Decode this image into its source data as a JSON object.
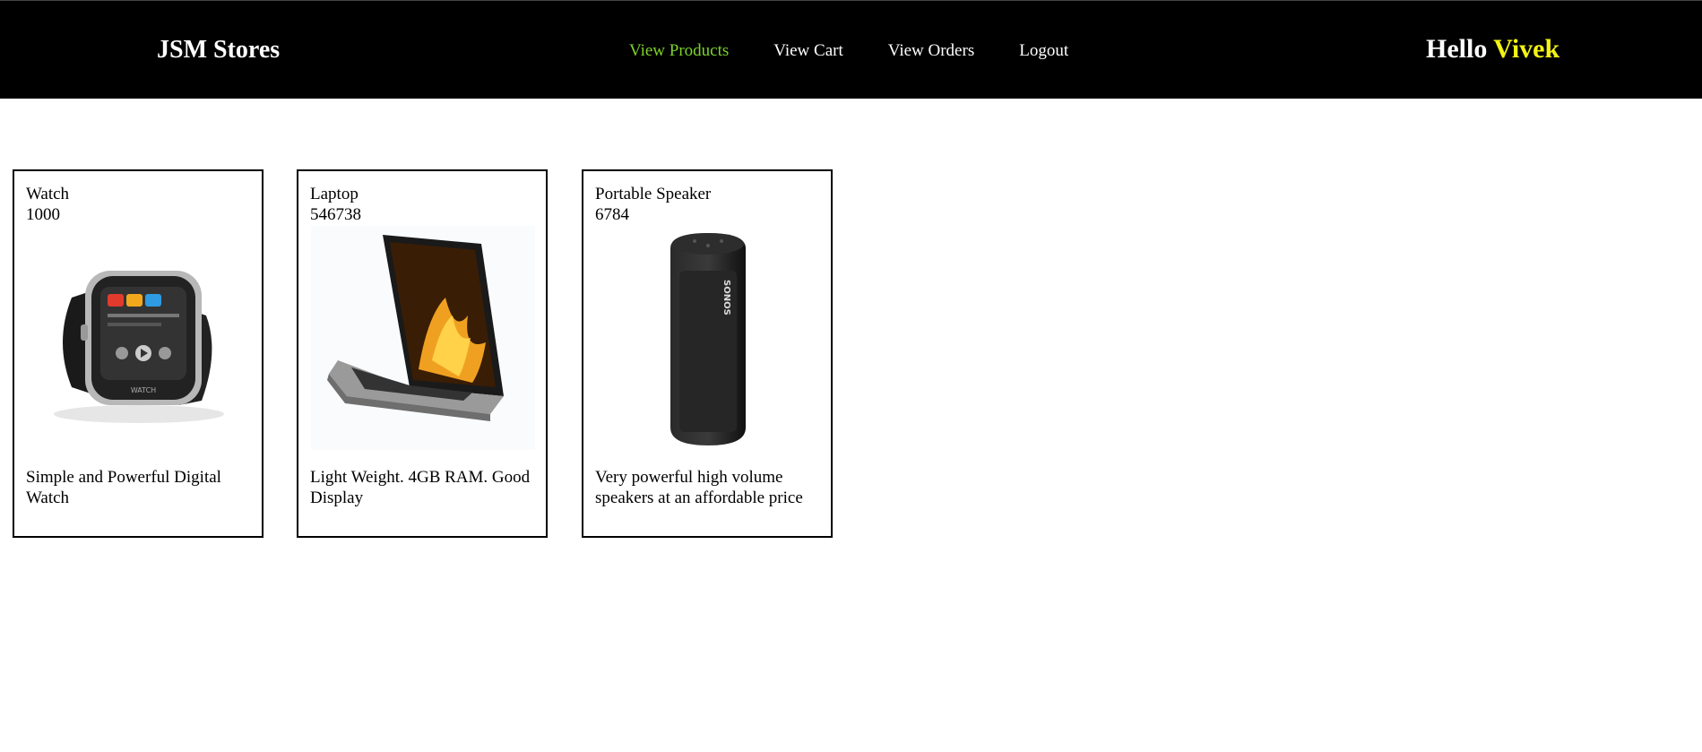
{
  "header": {
    "brand": "JSM Stores",
    "nav": [
      {
        "label": "View Products",
        "active": true
      },
      {
        "label": "View Cart",
        "active": false
      },
      {
        "label": "View Orders",
        "active": false
      },
      {
        "label": "Logout",
        "active": false
      }
    ],
    "greeting": "Hello",
    "username": "Vivek"
  },
  "colors": {
    "navbar_bg": "#000000",
    "active_link": "#7cd32b",
    "username": "#f3f315"
  },
  "products": [
    {
      "name": "Watch",
      "price": "1000",
      "image": "smartwatch-image",
      "description": "Simple and Powerful Digital Watch"
    },
    {
      "name": "Laptop",
      "price": "546738",
      "image": "laptop-image",
      "description": "Light Weight. 4GB RAM. Good Display"
    },
    {
      "name": "Portable Speaker",
      "price": "6784",
      "image": "speaker-image",
      "description": "Very powerful high volume speakers at an affordable price"
    }
  ]
}
